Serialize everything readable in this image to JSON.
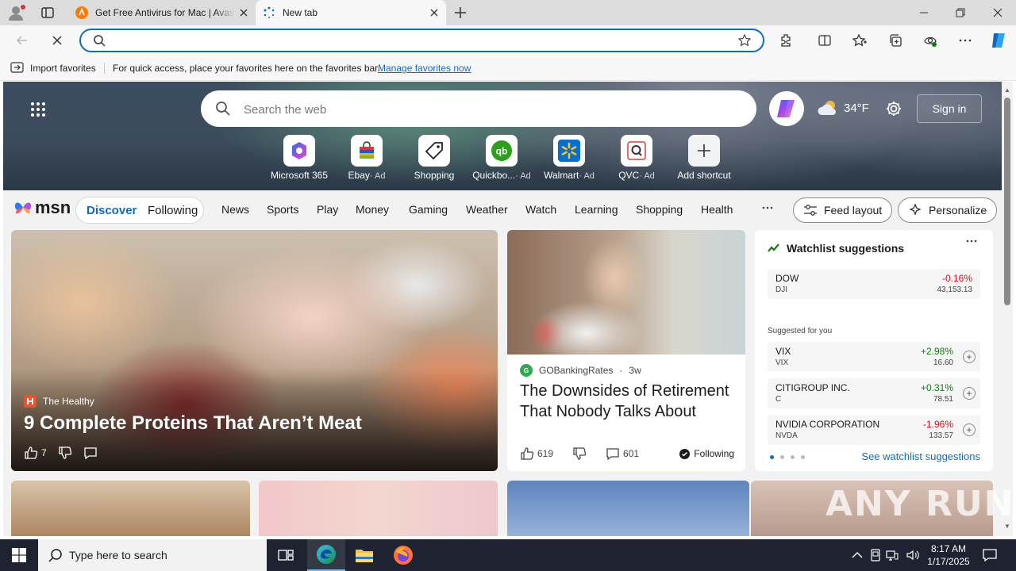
{
  "browser": {
    "tabs": [
      {
        "title": "Get Free Antivirus for Mac | Avast",
        "active": false
      },
      {
        "title": "New tab",
        "active": true
      }
    ],
    "address_bar": {
      "value": "",
      "placeholder": ""
    },
    "favorites_bar": {
      "import_label": "Import favorites",
      "message": "For quick access, place your favorites here on the favorites bar.",
      "link": "Manage favorites now"
    }
  },
  "newtab": {
    "search_placeholder": "Search the web",
    "weather": {
      "temp": "34°F",
      "icon": "cloudy-icon"
    },
    "signin_label": "Sign in",
    "shortcuts": [
      {
        "label": "Microsoft 365",
        "ad": ""
      },
      {
        "label": "Ebay",
        "ad": "· Ad"
      },
      {
        "label": "Shopping",
        "ad": ""
      },
      {
        "label": "Quickbo...",
        "ad": "· Ad"
      },
      {
        "label": "Walmart",
        "ad": "· Ad"
      },
      {
        "label": "QVC",
        "ad": "· Ad"
      },
      {
        "label": "Add shortcut",
        "ad": ""
      }
    ]
  },
  "msn": {
    "logo": "msn",
    "pill": {
      "discover": "Discover",
      "following": "Following"
    },
    "nav": [
      "News",
      "Sports",
      "Play",
      "Money",
      "Gaming",
      "Weather",
      "Watch",
      "Learning",
      "Shopping",
      "Health"
    ],
    "feed_layout": "Feed layout",
    "personalize": "Personalize"
  },
  "cards": {
    "big": {
      "source": "The Healthy",
      "headline": "9 Complete Proteins That Aren’t Meat",
      "likes": "7"
    },
    "mid": {
      "source": "GOBankingRates",
      "age": "3w",
      "headline": "The Downsides of Retirement That Nobody Talks About",
      "likes": "619",
      "comments": "601",
      "following": "Following"
    },
    "watchlist": {
      "title": "Watchlist suggestions",
      "main": {
        "name": "DOW",
        "symbol": "DJI",
        "change": "-0.16%",
        "price": "43,153.13"
      },
      "suggested_label": "Suggested for you",
      "items": [
        {
          "name": "VIX",
          "symbol": "VIX",
          "change": "+2.98%",
          "price": "16.60",
          "dir": "up"
        },
        {
          "name": "CITIGROUP INC.",
          "symbol": "C",
          "change": "+0.31%",
          "price": "78.51",
          "dir": "up"
        },
        {
          "name": "NVIDIA CORPORATION",
          "symbol": "NVDA",
          "change": "-1.96%",
          "price": "133.57",
          "dir": "down"
        }
      ],
      "see_all": "See watchlist suggestions"
    }
  },
  "watermark": "ANY RUN",
  "taskbar": {
    "search_placeholder": "Type here to search",
    "time": "8:17 AM",
    "date": "1/17/2025"
  }
}
